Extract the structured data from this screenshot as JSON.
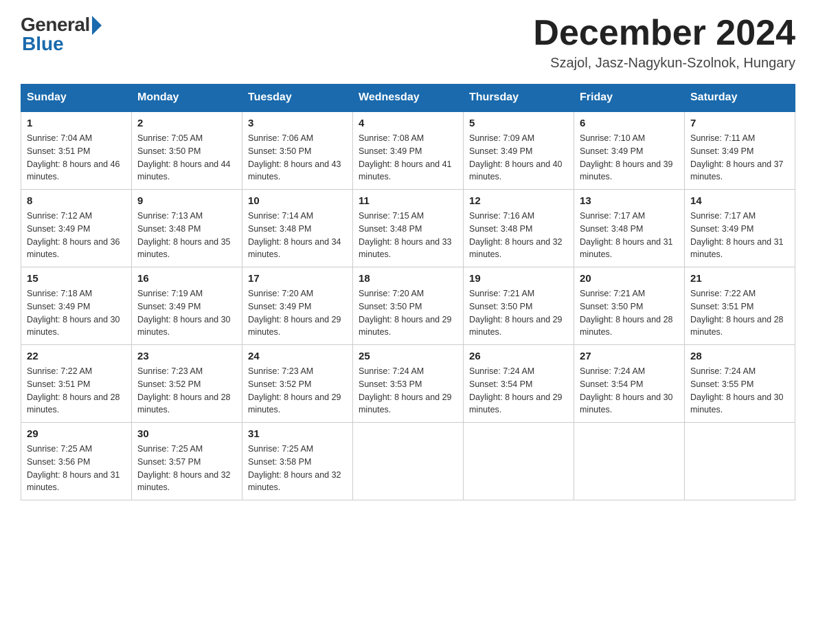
{
  "header": {
    "logo_general": "General",
    "logo_blue": "Blue",
    "month_title": "December 2024",
    "location": "Szajol, Jasz-Nagykun-Szolnok, Hungary"
  },
  "days_of_week": [
    "Sunday",
    "Monday",
    "Tuesday",
    "Wednesday",
    "Thursday",
    "Friday",
    "Saturday"
  ],
  "weeks": [
    [
      {
        "day": "1",
        "sunrise": "Sunrise: 7:04 AM",
        "sunset": "Sunset: 3:51 PM",
        "daylight": "Daylight: 8 hours and 46 minutes."
      },
      {
        "day": "2",
        "sunrise": "Sunrise: 7:05 AM",
        "sunset": "Sunset: 3:50 PM",
        "daylight": "Daylight: 8 hours and 44 minutes."
      },
      {
        "day": "3",
        "sunrise": "Sunrise: 7:06 AM",
        "sunset": "Sunset: 3:50 PM",
        "daylight": "Daylight: 8 hours and 43 minutes."
      },
      {
        "day": "4",
        "sunrise": "Sunrise: 7:08 AM",
        "sunset": "Sunset: 3:49 PM",
        "daylight": "Daylight: 8 hours and 41 minutes."
      },
      {
        "day": "5",
        "sunrise": "Sunrise: 7:09 AM",
        "sunset": "Sunset: 3:49 PM",
        "daylight": "Daylight: 8 hours and 40 minutes."
      },
      {
        "day": "6",
        "sunrise": "Sunrise: 7:10 AM",
        "sunset": "Sunset: 3:49 PM",
        "daylight": "Daylight: 8 hours and 39 minutes."
      },
      {
        "day": "7",
        "sunrise": "Sunrise: 7:11 AM",
        "sunset": "Sunset: 3:49 PM",
        "daylight": "Daylight: 8 hours and 37 minutes."
      }
    ],
    [
      {
        "day": "8",
        "sunrise": "Sunrise: 7:12 AM",
        "sunset": "Sunset: 3:49 PM",
        "daylight": "Daylight: 8 hours and 36 minutes."
      },
      {
        "day": "9",
        "sunrise": "Sunrise: 7:13 AM",
        "sunset": "Sunset: 3:48 PM",
        "daylight": "Daylight: 8 hours and 35 minutes."
      },
      {
        "day": "10",
        "sunrise": "Sunrise: 7:14 AM",
        "sunset": "Sunset: 3:48 PM",
        "daylight": "Daylight: 8 hours and 34 minutes."
      },
      {
        "day": "11",
        "sunrise": "Sunrise: 7:15 AM",
        "sunset": "Sunset: 3:48 PM",
        "daylight": "Daylight: 8 hours and 33 minutes."
      },
      {
        "day": "12",
        "sunrise": "Sunrise: 7:16 AM",
        "sunset": "Sunset: 3:48 PM",
        "daylight": "Daylight: 8 hours and 32 minutes."
      },
      {
        "day": "13",
        "sunrise": "Sunrise: 7:17 AM",
        "sunset": "Sunset: 3:48 PM",
        "daylight": "Daylight: 8 hours and 31 minutes."
      },
      {
        "day": "14",
        "sunrise": "Sunrise: 7:17 AM",
        "sunset": "Sunset: 3:49 PM",
        "daylight": "Daylight: 8 hours and 31 minutes."
      }
    ],
    [
      {
        "day": "15",
        "sunrise": "Sunrise: 7:18 AM",
        "sunset": "Sunset: 3:49 PM",
        "daylight": "Daylight: 8 hours and 30 minutes."
      },
      {
        "day": "16",
        "sunrise": "Sunrise: 7:19 AM",
        "sunset": "Sunset: 3:49 PM",
        "daylight": "Daylight: 8 hours and 30 minutes."
      },
      {
        "day": "17",
        "sunrise": "Sunrise: 7:20 AM",
        "sunset": "Sunset: 3:49 PM",
        "daylight": "Daylight: 8 hours and 29 minutes."
      },
      {
        "day": "18",
        "sunrise": "Sunrise: 7:20 AM",
        "sunset": "Sunset: 3:50 PM",
        "daylight": "Daylight: 8 hours and 29 minutes."
      },
      {
        "day": "19",
        "sunrise": "Sunrise: 7:21 AM",
        "sunset": "Sunset: 3:50 PM",
        "daylight": "Daylight: 8 hours and 29 minutes."
      },
      {
        "day": "20",
        "sunrise": "Sunrise: 7:21 AM",
        "sunset": "Sunset: 3:50 PM",
        "daylight": "Daylight: 8 hours and 28 minutes."
      },
      {
        "day": "21",
        "sunrise": "Sunrise: 7:22 AM",
        "sunset": "Sunset: 3:51 PM",
        "daylight": "Daylight: 8 hours and 28 minutes."
      }
    ],
    [
      {
        "day": "22",
        "sunrise": "Sunrise: 7:22 AM",
        "sunset": "Sunset: 3:51 PM",
        "daylight": "Daylight: 8 hours and 28 minutes."
      },
      {
        "day": "23",
        "sunrise": "Sunrise: 7:23 AM",
        "sunset": "Sunset: 3:52 PM",
        "daylight": "Daylight: 8 hours and 28 minutes."
      },
      {
        "day": "24",
        "sunrise": "Sunrise: 7:23 AM",
        "sunset": "Sunset: 3:52 PM",
        "daylight": "Daylight: 8 hours and 29 minutes."
      },
      {
        "day": "25",
        "sunrise": "Sunrise: 7:24 AM",
        "sunset": "Sunset: 3:53 PM",
        "daylight": "Daylight: 8 hours and 29 minutes."
      },
      {
        "day": "26",
        "sunrise": "Sunrise: 7:24 AM",
        "sunset": "Sunset: 3:54 PM",
        "daylight": "Daylight: 8 hours and 29 minutes."
      },
      {
        "day": "27",
        "sunrise": "Sunrise: 7:24 AM",
        "sunset": "Sunset: 3:54 PM",
        "daylight": "Daylight: 8 hours and 30 minutes."
      },
      {
        "day": "28",
        "sunrise": "Sunrise: 7:24 AM",
        "sunset": "Sunset: 3:55 PM",
        "daylight": "Daylight: 8 hours and 30 minutes."
      }
    ],
    [
      {
        "day": "29",
        "sunrise": "Sunrise: 7:25 AM",
        "sunset": "Sunset: 3:56 PM",
        "daylight": "Daylight: 8 hours and 31 minutes."
      },
      {
        "day": "30",
        "sunrise": "Sunrise: 7:25 AM",
        "sunset": "Sunset: 3:57 PM",
        "daylight": "Daylight: 8 hours and 32 minutes."
      },
      {
        "day": "31",
        "sunrise": "Sunrise: 7:25 AM",
        "sunset": "Sunset: 3:58 PM",
        "daylight": "Daylight: 8 hours and 32 minutes."
      },
      null,
      null,
      null,
      null
    ]
  ]
}
